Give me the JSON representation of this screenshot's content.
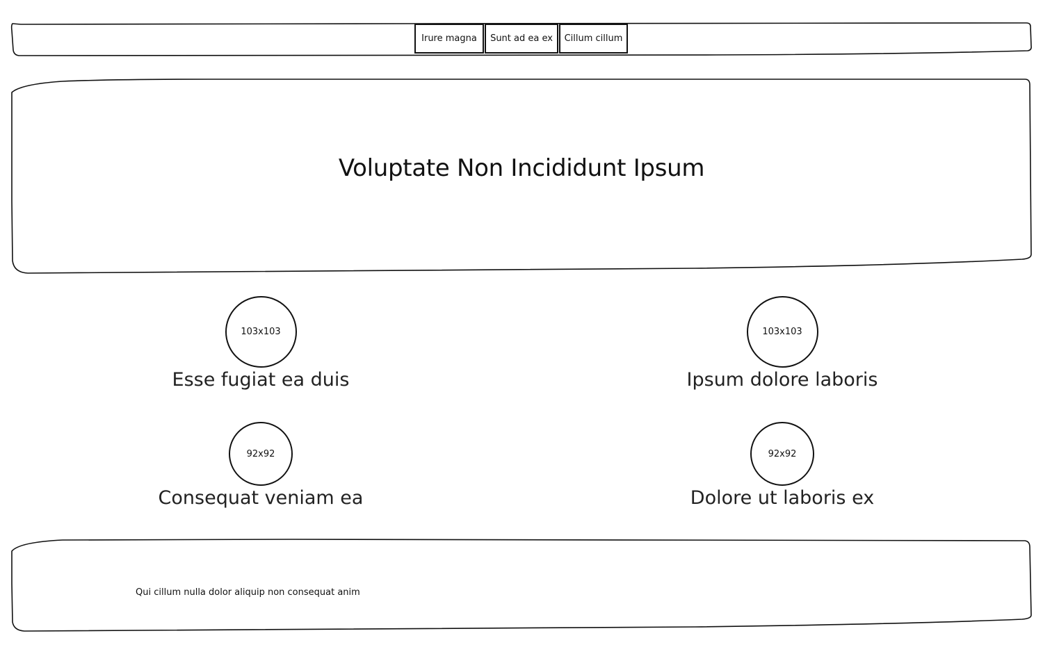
{
  "nav": {
    "items": [
      {
        "label": "Irure magna"
      },
      {
        "label": "Sunt ad ea ex"
      },
      {
        "label": "Cillum cillum"
      }
    ]
  },
  "hero": {
    "title": "Voluptate Non Incididunt Ipsum"
  },
  "features": [
    {
      "image_label": "103x103",
      "title": "Esse fugiat ea duis"
    },
    {
      "image_label": "103x103",
      "title": "Ipsum dolore laboris"
    },
    {
      "image_label": "92x92",
      "title": "Consequat veniam ea"
    },
    {
      "image_label": "92x92",
      "title": "Dolore ut laboris ex"
    }
  ],
  "footer": {
    "text": "Qui cillum nulla dolor aliquip non consequat anim"
  }
}
